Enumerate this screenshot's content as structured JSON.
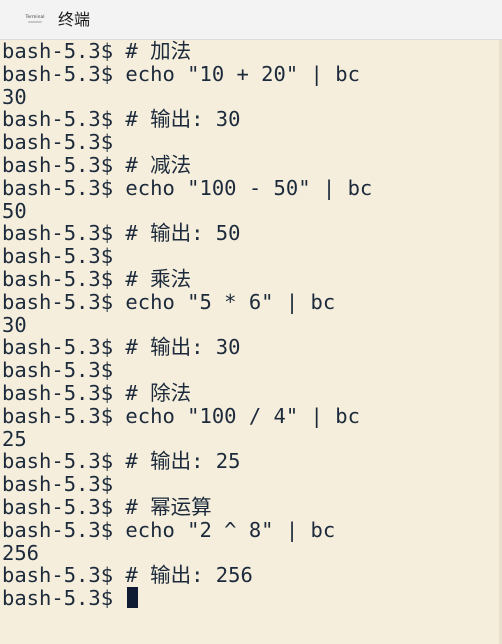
{
  "window": {
    "title": "终端",
    "app_icon_label": "Terminal"
  },
  "terminal": {
    "lines": [
      "bash-5.3$ # 加法",
      "bash-5.3$ echo \"10 + 20\" | bc",
      "30",
      "bash-5.3$ # 输出: 30",
      "bash-5.3$",
      "bash-5.3$ # 减法",
      "bash-5.3$ echo \"100 - 50\" | bc",
      "50",
      "bash-5.3$ # 输出: 50",
      "bash-5.3$",
      "bash-5.3$ # 乘法",
      "bash-5.3$ echo \"5 * 6\" | bc",
      "30",
      "bash-5.3$ # 输出: 30",
      "bash-5.3$",
      "bash-5.3$ # 除法",
      "bash-5.3$ echo \"100 / 4\" | bc",
      "25",
      "bash-5.3$ # 输出: 25",
      "bash-5.3$",
      "bash-5.3$ # 幂运算",
      "bash-5.3$ echo \"2 ^ 8\" | bc",
      "256",
      "bash-5.3$ # 输出: 256"
    ],
    "prompt": "bash-5.3$ ",
    "colors": {
      "background": "#f5eedc",
      "foreground": "#1c2a3b",
      "cursor": "#0f1b33"
    }
  }
}
